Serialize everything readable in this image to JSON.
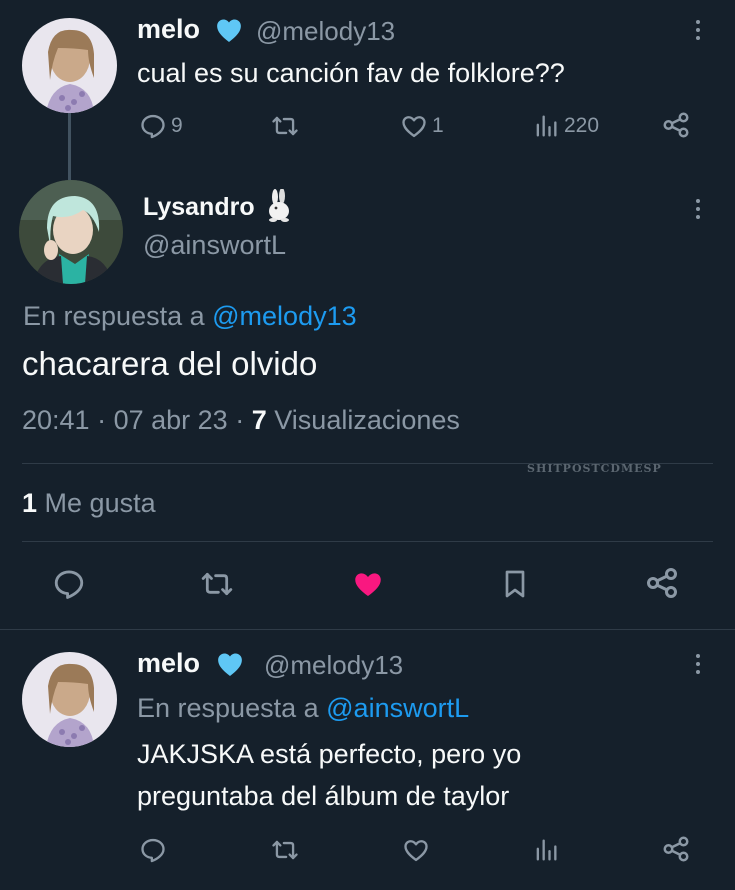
{
  "colors": {
    "background": "#15202b",
    "text": "#f7f9f9",
    "muted": "#8b98a5",
    "link": "#1d9bf0",
    "like": "#f91880",
    "verified": "#5fc7f5"
  },
  "tweet1": {
    "name": "melo",
    "verified": true,
    "handle": "@melody13",
    "text": "cual es su canción fav de folklore??",
    "replies": "9",
    "retweets": "",
    "likes": "1",
    "views": "220",
    "icons": [
      "more-icon",
      "reply-icon",
      "retweet-icon",
      "like-icon",
      "views-icon",
      "share-icon"
    ]
  },
  "tweet2": {
    "name": "Lysandro",
    "name_emoji": "rabbit-emoji",
    "handle": "@ainswortL",
    "reply_prefix": "En respuesta a",
    "reply_to": "@melody13",
    "text": "chacarera del olvido",
    "time": "20:41",
    "date": "07 abr 23",
    "views_count": "7",
    "views_label": "Visualizaciones",
    "likes_count": "1",
    "likes_label": "Me gusta",
    "liked": true,
    "icons": [
      "more-icon",
      "reply-icon",
      "retweet-icon",
      "like-icon-filled",
      "bookmark-icon",
      "share-icon"
    ]
  },
  "tweet3": {
    "name": "melo",
    "verified": true,
    "handle": "@melody13",
    "reply_prefix": "En respuesta a",
    "reply_to": "@ainswortL",
    "text_line1": "JAKJSKA está perfecto, pero yo",
    "text_line2": "preguntaba del álbum de taylor",
    "icons": [
      "more-icon",
      "reply-icon",
      "retweet-icon",
      "like-icon",
      "views-icon",
      "share-icon"
    ]
  },
  "watermark": "SHITPOSTCDMESP"
}
